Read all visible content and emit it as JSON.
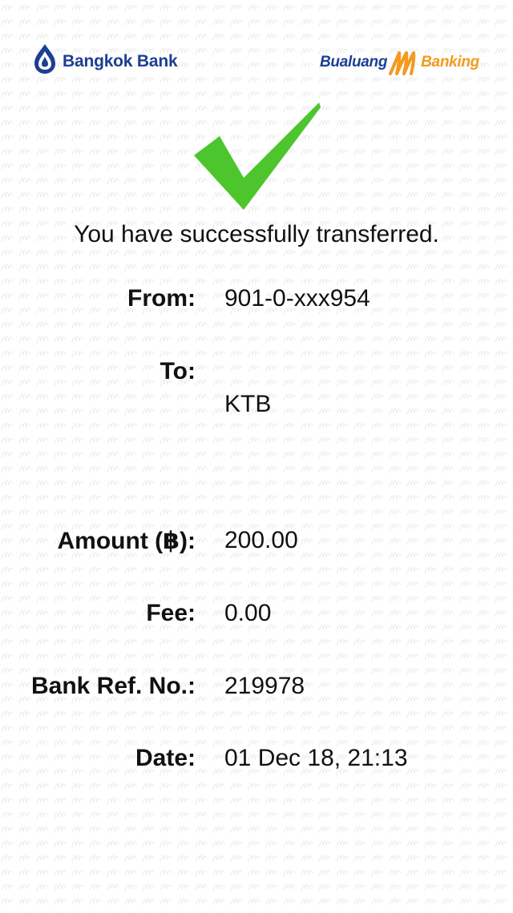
{
  "header": {
    "bank_logo_text": "Bangkok Bank",
    "app_logo": {
      "prefix": "Bualuang",
      "mark": "m",
      "suffix": "Banking"
    }
  },
  "status": {
    "icon": "check-icon",
    "message": "You have successfully transferred."
  },
  "details": {
    "from": {
      "label": "From:",
      "value": "901-0-xxx954"
    },
    "to": {
      "label": "To:",
      "value": "KTB"
    },
    "amount": {
      "label": "Amount (฿):",
      "value": "200.00"
    },
    "fee": {
      "label": "Fee:",
      "value": "0.00"
    },
    "ref": {
      "label": "Bank Ref. No.:",
      "value": "219978"
    },
    "date": {
      "label": "Date:",
      "value": "01 Dec 18, 21:13"
    }
  },
  "colors": {
    "brand_blue": "#1d3f93",
    "brand_orange": "#f39a1f",
    "success_green": "#4cc62c",
    "text": "#111111",
    "background": "#ffffff"
  }
}
